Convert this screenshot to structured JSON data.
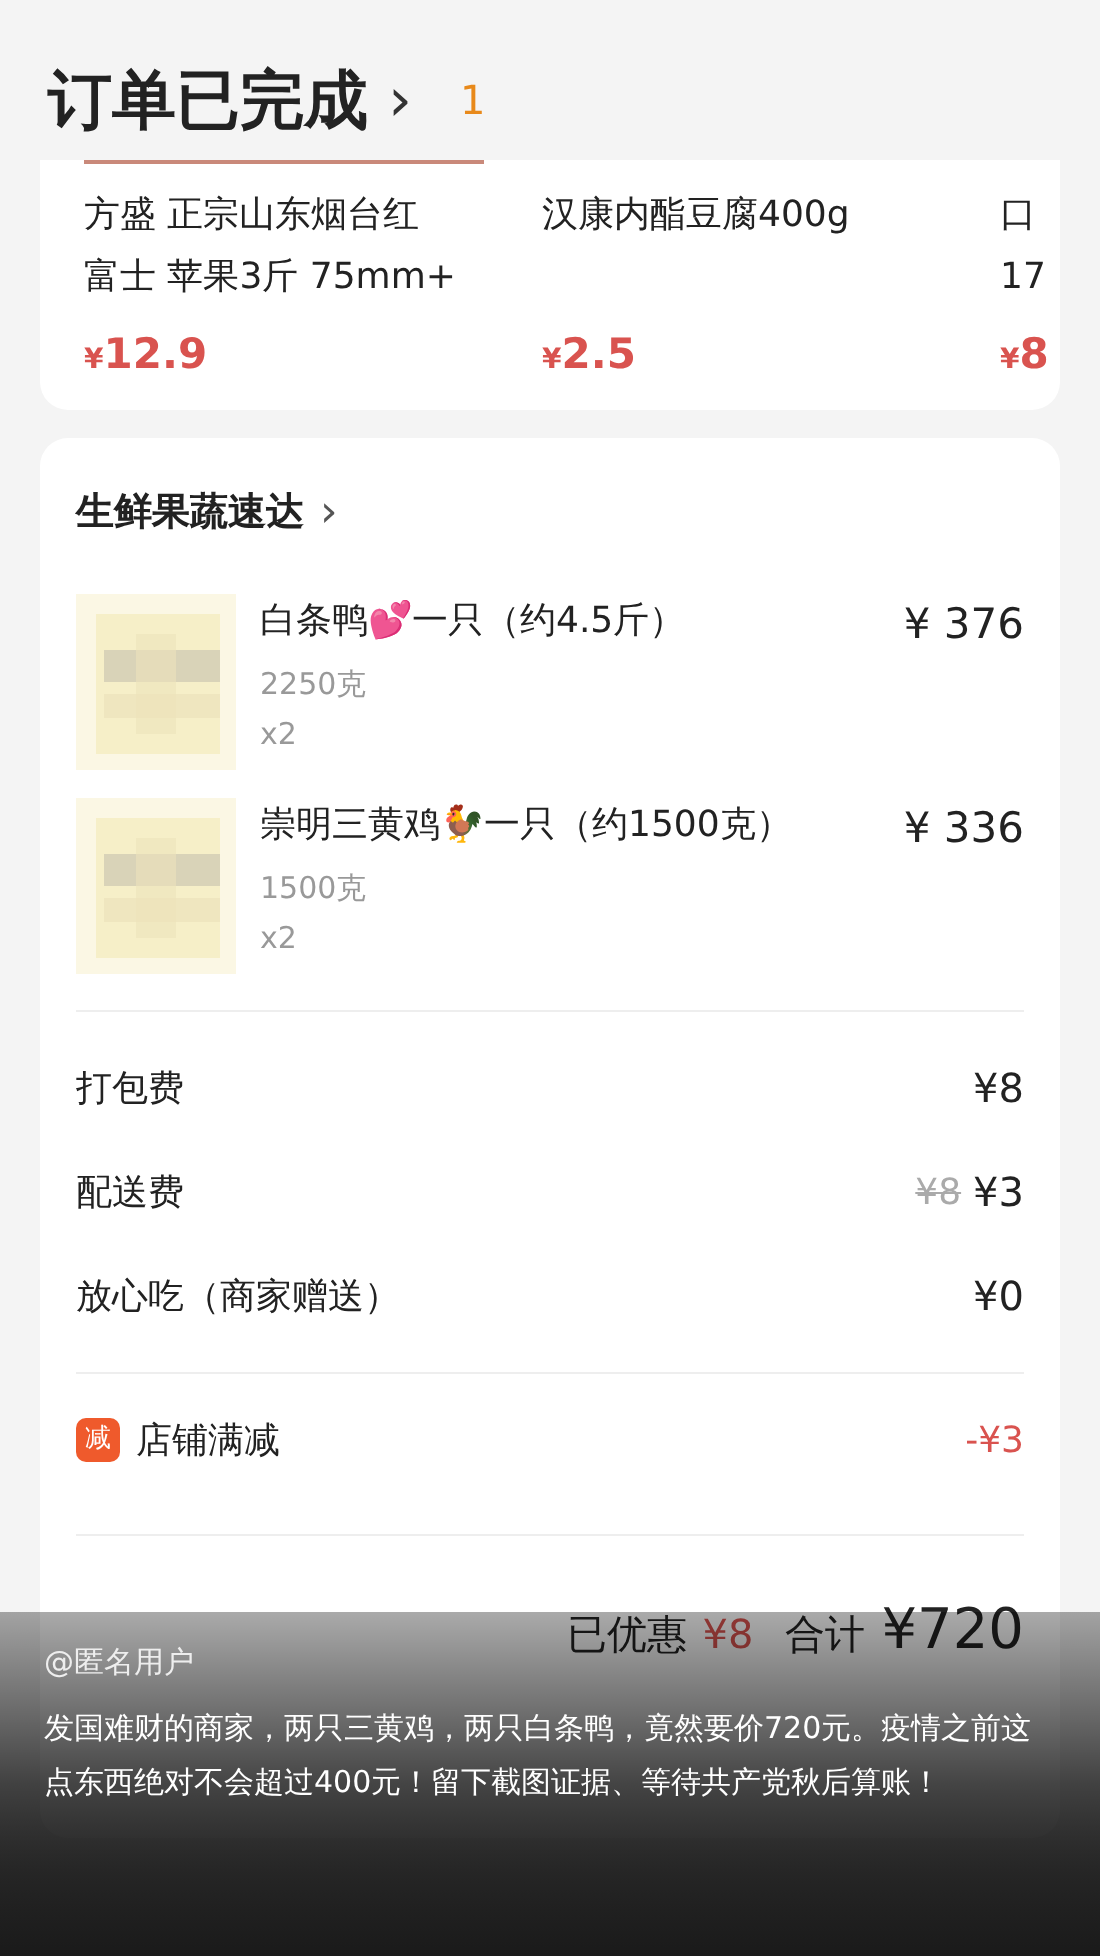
{
  "header": {
    "title": "订单已完成",
    "chevron": "›",
    "badge": "1"
  },
  "recommended": [
    {
      "name_lines": [
        "方盛 正宗山东烟台红",
        "富士 苹果3斤 75mm+"
      ],
      "currency": "¥",
      "price": "12.9"
    },
    {
      "name_lines": [
        "汉康内酯豆腐400g"
      ],
      "currency": "¥",
      "price": "2.5"
    },
    {
      "name_lines": [
        "口",
        "17"
      ],
      "currency": "¥",
      "price": "8"
    }
  ],
  "store": {
    "name": "生鲜果蔬速达",
    "chevron": "›"
  },
  "items": [
    {
      "kind": "picture",
      "name": "白条鸭💕一只（约4.5斤）",
      "price": "¥ 376",
      "spec": "2250克",
      "qty": "x2"
    },
    {
      "kind": "picture",
      "name": "崇明三黄鸡🐓一只（约1500克）",
      "price": "¥ 336",
      "spec": "1500克",
      "qty": "x2"
    }
  ],
  "fees": [
    {
      "label": "打包费",
      "price": "¥8"
    },
    {
      "label": "配送费",
      "original": "¥8",
      "price": "¥3"
    },
    {
      "label": "放心吃（商家赠送）",
      "price": "¥0"
    }
  ],
  "discount": {
    "tag": "减",
    "label": "店铺满减",
    "amount": "-¥3"
  },
  "summary": {
    "saved_label": "已优惠",
    "saved": "¥8",
    "total_label": "合计",
    "total": "¥720"
  },
  "caption": {
    "user": "@匿名用户",
    "text": "发国难财的商家，两只三黄鸡，两只白条鸭，竟然要价720元。疫情之前这点东西绝对不会超过400元！留下截图证据、等待共产党秋后算账！"
  }
}
